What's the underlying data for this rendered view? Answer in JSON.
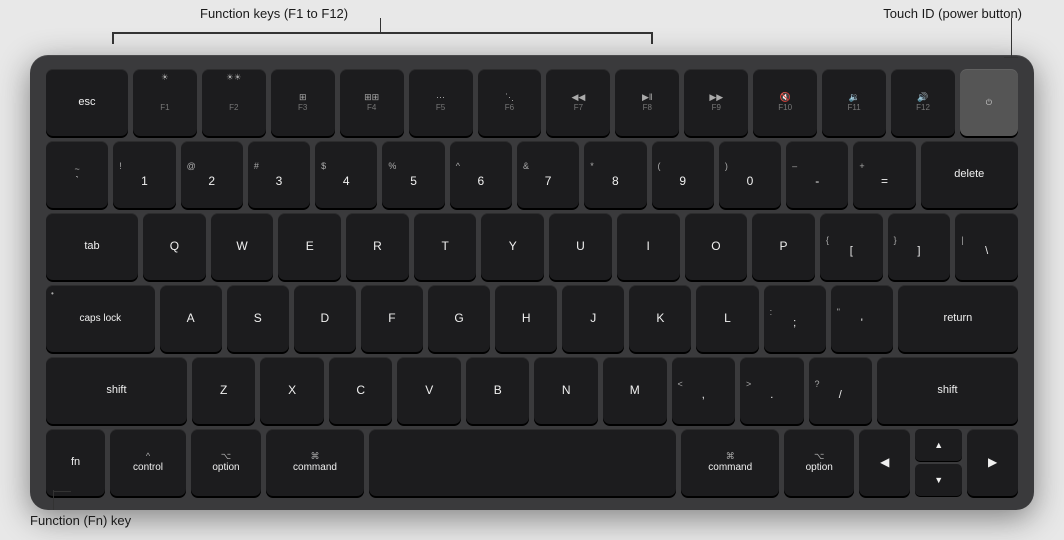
{
  "annotations": {
    "function_keys_label": "Function keys (F1 to F12)",
    "touchid_label": "Touch ID (power button)",
    "fn_key_label": "Function (Fn) key"
  },
  "keyboard": {
    "rows": {
      "row0": [
        "esc",
        "F1",
        "F2",
        "F3",
        "F4",
        "F5",
        "F6",
        "F7",
        "F8",
        "F9",
        "F10",
        "F11",
        "F12",
        "TouchID"
      ],
      "row1": [
        "~`",
        "!1",
        "@2",
        "#3",
        "$4",
        "%5",
        "^6",
        "&7",
        "*8",
        "(9",
        ")0",
        "-–",
        "+=",
        "delete"
      ],
      "row2": [
        "tab",
        "Q",
        "W",
        "E",
        "R",
        "T",
        "Y",
        "U",
        "I",
        "O",
        "P",
        "{[",
        "}]",
        "|\\"
      ],
      "row3": [
        "caps lock",
        "A",
        "S",
        "D",
        "F",
        "G",
        "H",
        "J",
        "K",
        "L",
        ";:",
        "\"'",
        "return"
      ],
      "row4": [
        "shift",
        "Z",
        "X",
        "C",
        "V",
        "B",
        "N",
        "M",
        "<,",
        ">.",
        "?/",
        "shift"
      ],
      "row5": [
        "fn",
        "control",
        "option",
        "command",
        "space",
        "command",
        "option",
        "◄",
        "▲▼",
        "►"
      ]
    }
  }
}
